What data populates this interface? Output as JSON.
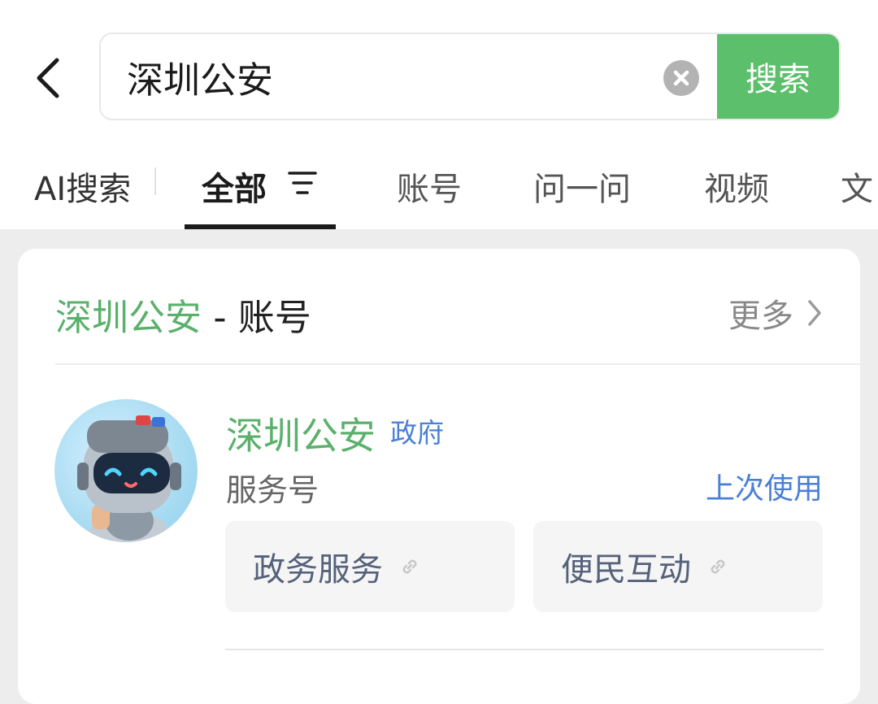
{
  "search": {
    "query": "深圳公安",
    "button_label": "搜索"
  },
  "tabs": {
    "ai_label": "AI搜索",
    "items": [
      "全部",
      "账号",
      "问一问",
      "视频",
      "文"
    ]
  },
  "result_card": {
    "keyword": "深圳公安",
    "title_suffix": " - 账号",
    "more_label": "更多",
    "account": {
      "name": "深圳公安",
      "tag": "政府",
      "type": "服务号",
      "last_used": "上次使用",
      "menus": [
        "政务服务",
        "便民互动"
      ]
    }
  },
  "colors": {
    "accent_green": "#5bbf6b",
    "keyword_green": "#5bb06b",
    "link_blue": "#4a7fd6"
  }
}
